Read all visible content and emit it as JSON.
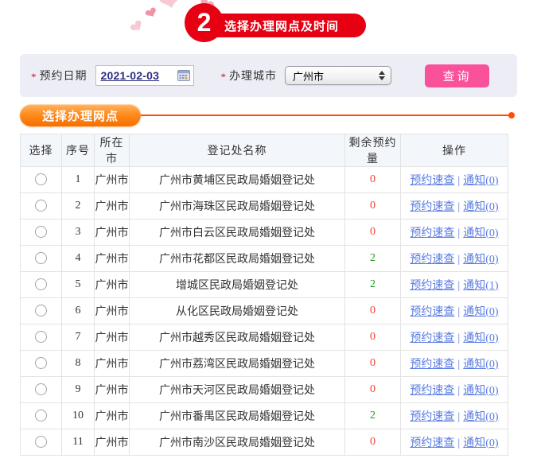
{
  "banner": {
    "step_number": "2",
    "title": "选择办理网点及时间"
  },
  "filters": {
    "required_marker": "*",
    "date_label": "预约日期",
    "date_value": "2021-02-03",
    "city_label": "办理城市",
    "city_value": "广州市",
    "search_button": "查询"
  },
  "section": {
    "title": "选择办理网点"
  },
  "icons": {
    "hearts": "heart-icon",
    "calendar": "calendar-icon",
    "select_stepper": "up-down-arrows-icon",
    "line_end": "dot-icon"
  },
  "table": {
    "headers": [
      "选择",
      "序号",
      "所在市",
      "登记处名称",
      "剩余预约量",
      "操作"
    ],
    "quick_check_label": "预约速查",
    "separator": "|",
    "rows": [
      {
        "no": "1",
        "city": "广州市",
        "name": "广州市黄埔区民政局婚姻登记处",
        "remaining": "0",
        "notice": "通知(0)"
      },
      {
        "no": "2",
        "city": "广州市",
        "name": "广州市海珠区民政局婚姻登记处",
        "remaining": "0",
        "notice": "通知(0)"
      },
      {
        "no": "3",
        "city": "广州市",
        "name": "广州市白云区民政局婚姻登记处",
        "remaining": "0",
        "notice": "通知(0)"
      },
      {
        "no": "4",
        "city": "广州市",
        "name": "广州市花都区民政局婚姻登记处",
        "remaining": "2",
        "notice": "通知(0)"
      },
      {
        "no": "5",
        "city": "广州市",
        "name": "增城区民政局婚姻登记处",
        "remaining": "2",
        "notice": "通知(1)"
      },
      {
        "no": "6",
        "city": "广州市",
        "name": "从化区民政局婚姻登记处",
        "remaining": "0",
        "notice": "通知(0)"
      },
      {
        "no": "7",
        "city": "广州市",
        "name": "广州市越秀区民政局婚姻登记处",
        "remaining": "0",
        "notice": "通知(0)"
      },
      {
        "no": "8",
        "city": "广州市",
        "name": "广州市荔湾区民政局婚姻登记处",
        "remaining": "0",
        "notice": "通知(0)"
      },
      {
        "no": "9",
        "city": "广州市",
        "name": "广州市天河区民政局婚姻登记处",
        "remaining": "0",
        "notice": "通知(0)"
      },
      {
        "no": "10",
        "city": "广州市",
        "name": "广州市番禺区民政局婚姻登记处",
        "remaining": "2",
        "notice": "通知(0)"
      },
      {
        "no": "11",
        "city": "广州市",
        "name": "广州市南沙区民政局婚姻登记处",
        "remaining": "0",
        "notice": "通知(0)"
      }
    ]
  },
  "colors": {
    "accent_red": "#e60012",
    "pink_button": "#f9529b",
    "orange_line": "#ff4e00",
    "link_blue": "#5a7ce2",
    "remaining_zero": "#f5392b",
    "remaining_available": "#1b9a1b",
    "filter_bg": "#ededf6",
    "table_header_bg": "#f3f6fb"
  }
}
